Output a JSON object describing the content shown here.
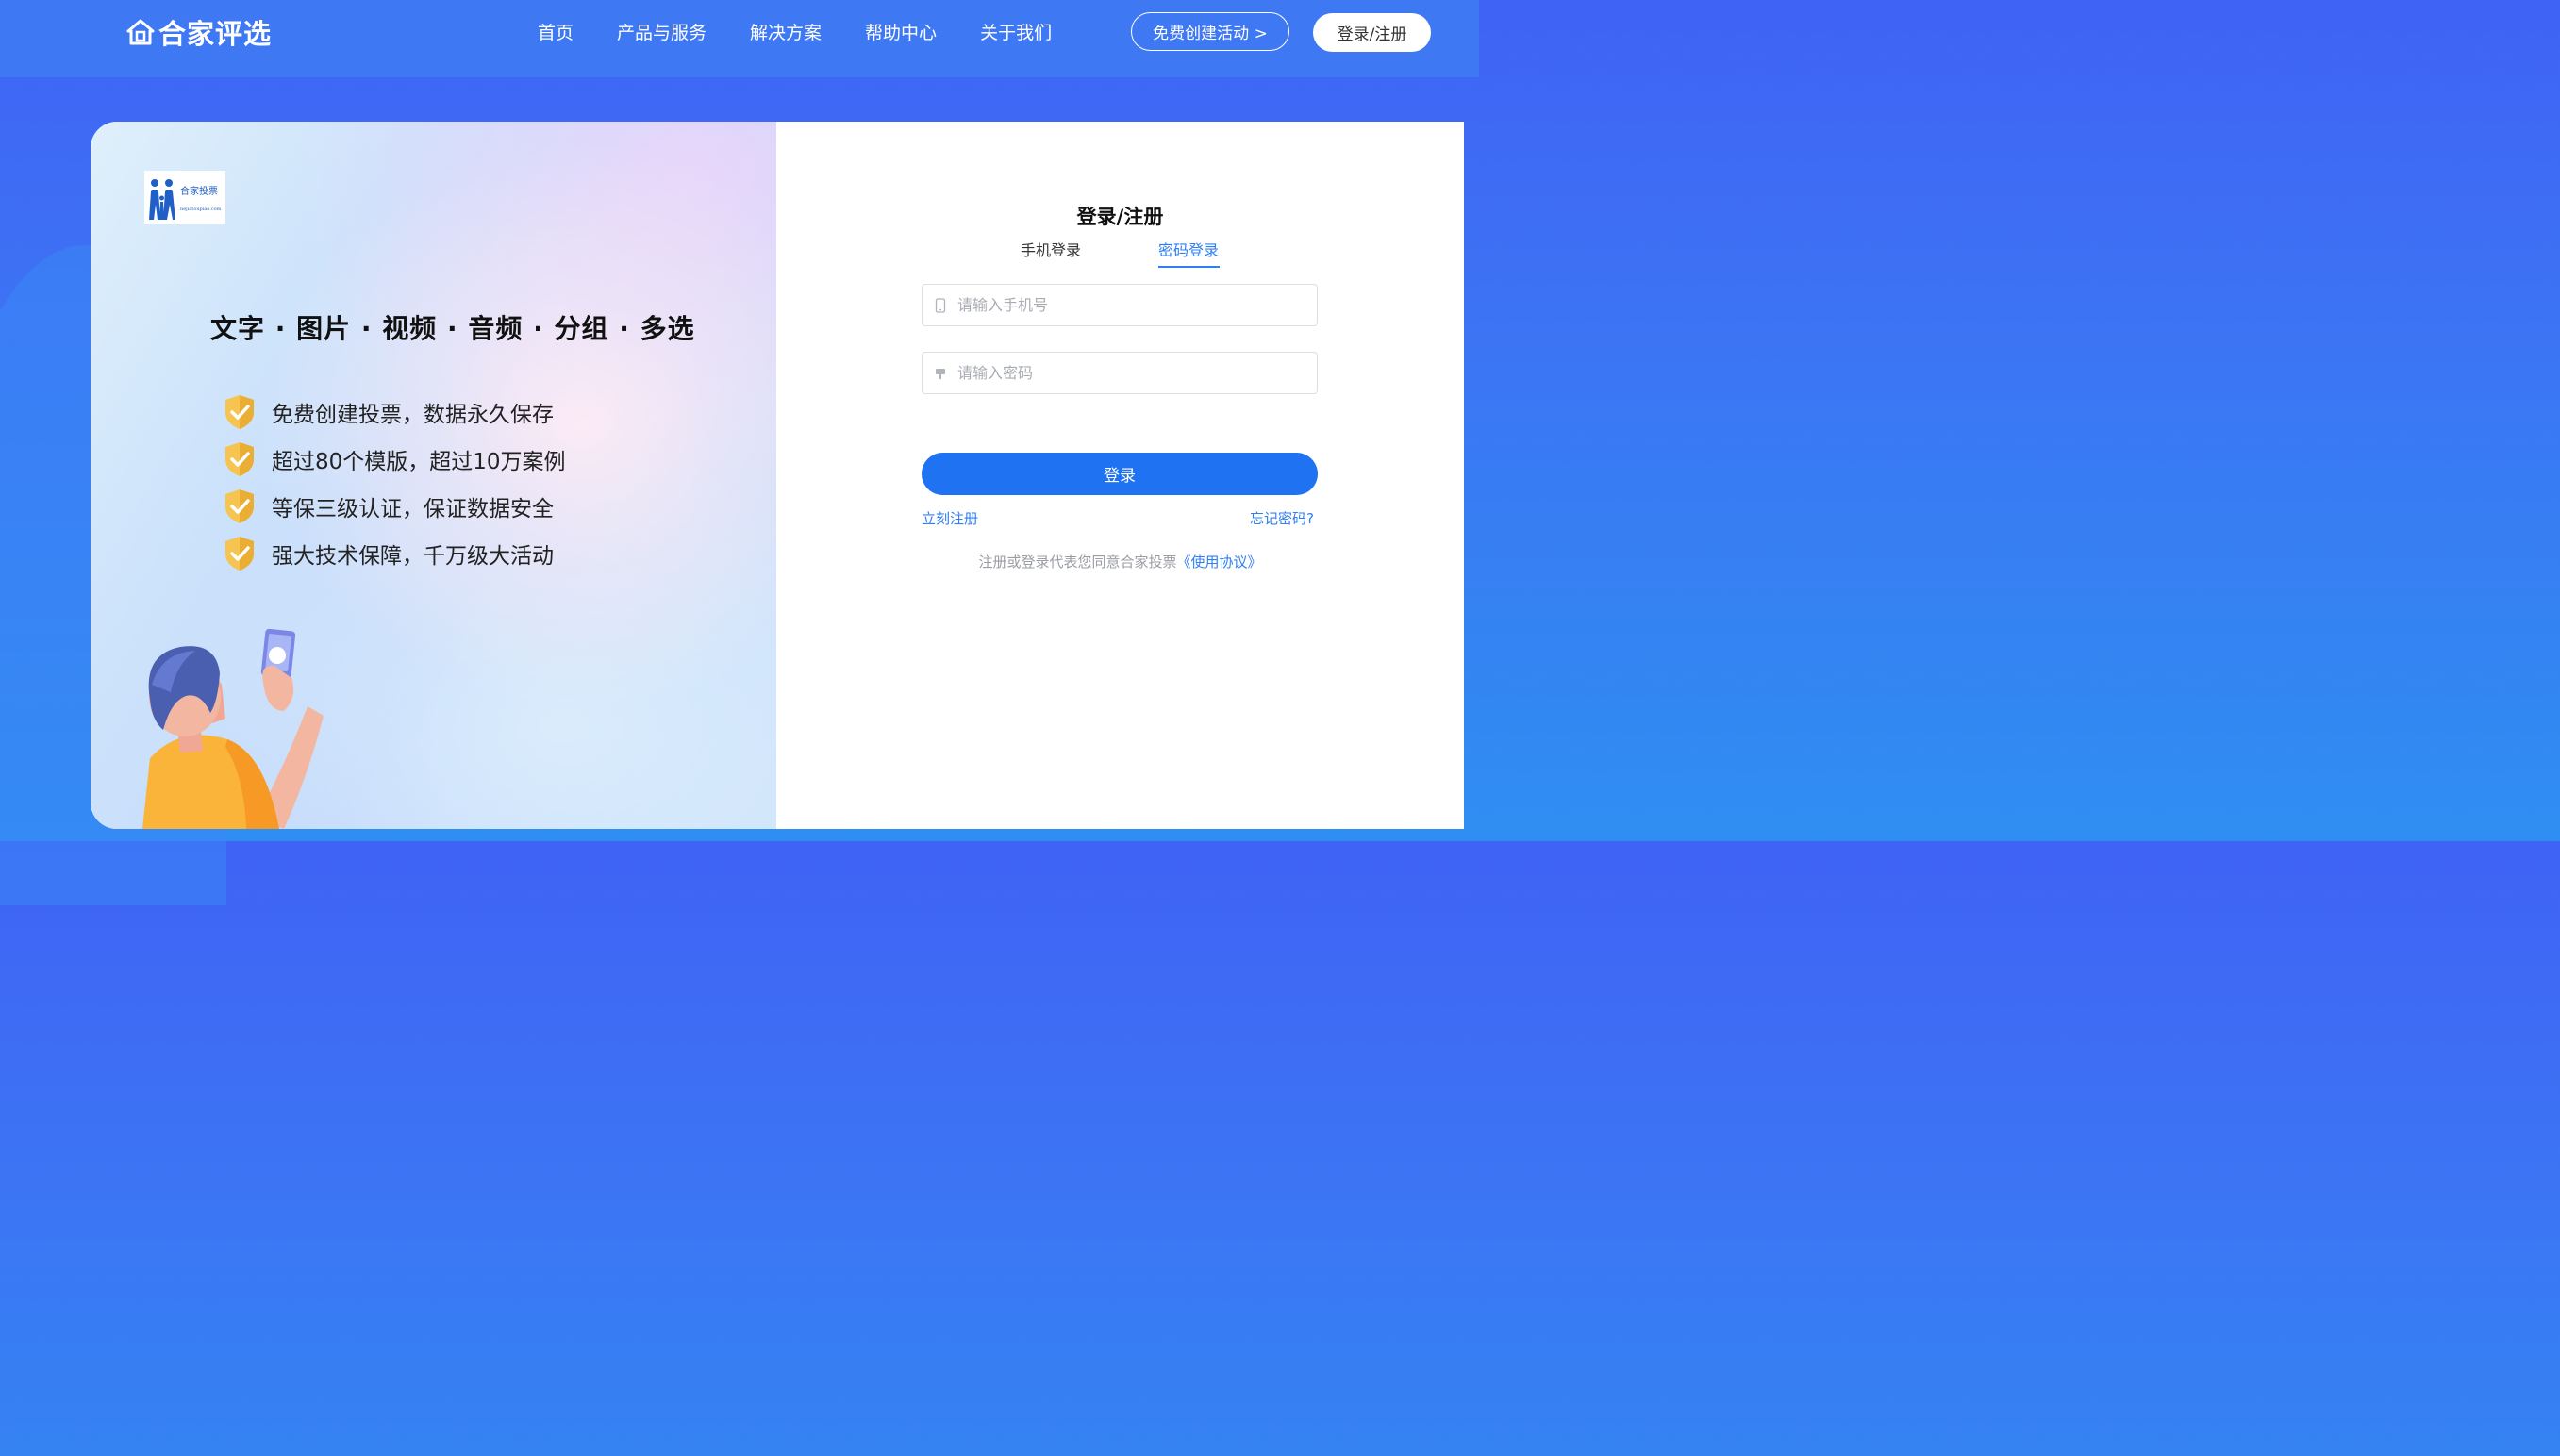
{
  "header": {
    "logo_text": "合家评选",
    "nav": [
      "首页",
      "产品与服务",
      "解决方案",
      "帮助中心",
      "关于我们"
    ],
    "create_button": "免费创建活动 >",
    "login_button": "登录/注册"
  },
  "promo": {
    "mini_logo_title": "合家投票",
    "mini_logo_url": "hejiatoupiao.com",
    "headline": "文字 · 图片 · 视频 · 音频 · 分组 · 多选",
    "features": [
      "免费创建投票，数据永久保存",
      "超过80个模版，超过10万案例",
      "等保三级认证，保证数据安全",
      "强大技术保障，千万级大活动"
    ]
  },
  "form": {
    "title": "登录/注册",
    "tabs": [
      "手机登录",
      "密码登录"
    ],
    "active_tab": "密码登录",
    "phone_placeholder": "请输入手机号",
    "password_placeholder": "请输入密码",
    "submit_label": "登录",
    "register_link": "立刻注册",
    "forgot_link": "忘记密码?",
    "agreement_text": "注册或登录代表您同意合家投票",
    "agreement_link": "《使用协议》"
  },
  "colors": {
    "header_bg": "#3f78f3",
    "accent": "#2f7ef4",
    "submit_bg": "#1f73f2"
  }
}
